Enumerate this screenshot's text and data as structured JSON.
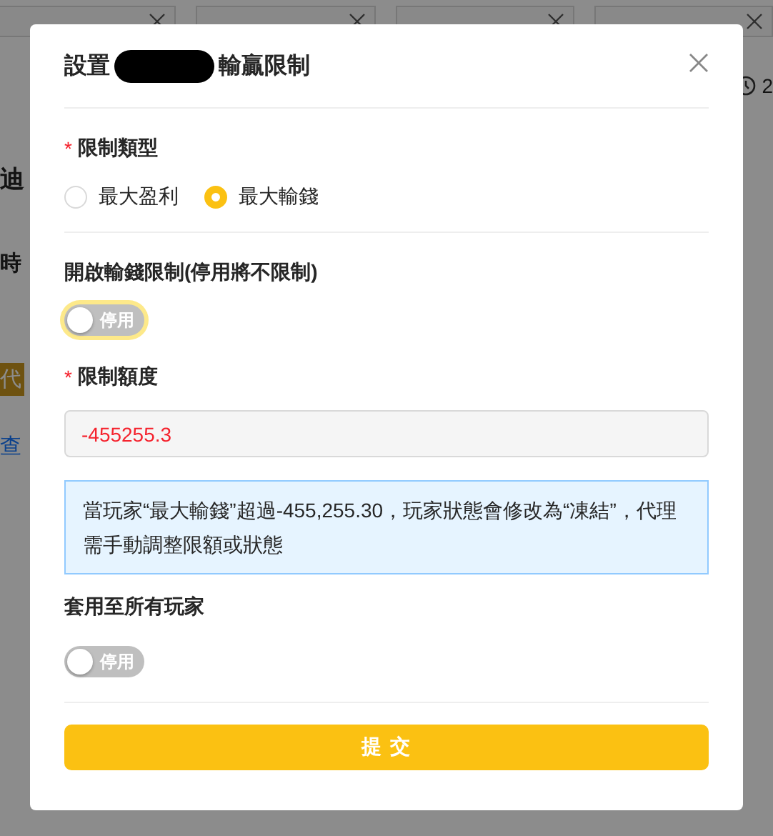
{
  "background": {
    "side_items": [
      {
        "kind": "heading",
        "text": "迪"
      },
      {
        "kind": "label",
        "text": "時"
      },
      {
        "kind": "tag",
        "text": "代"
      },
      {
        "kind": "link",
        "text": "查"
      }
    ],
    "clock_text": "2"
  },
  "dialog": {
    "title_start": "設置",
    "title_end": "輸贏限制",
    "limit_type": {
      "label": "限制類型",
      "required_mark": "*",
      "options": [
        {
          "label": "最大盈利",
          "selected": false
        },
        {
          "label": "最大輸錢",
          "selected": true
        }
      ]
    },
    "loss_limit": {
      "label": "開啟輸錢限制(停用將不限制)",
      "on": false,
      "focused": true,
      "toggle_text": "停用"
    },
    "amount": {
      "label": "限制額度",
      "required_mark": "*",
      "value": "-455255.3",
      "disabled": true
    },
    "notice": "當玩家“最大輸錢”超過-455,255.30，玩家狀態會修改為“凍結”，代理需手動調整限額或狀態",
    "apply_all": {
      "label": "套用至所有玩家",
      "on": false,
      "toggle_text": "停用"
    },
    "submit": "提 交"
  }
}
